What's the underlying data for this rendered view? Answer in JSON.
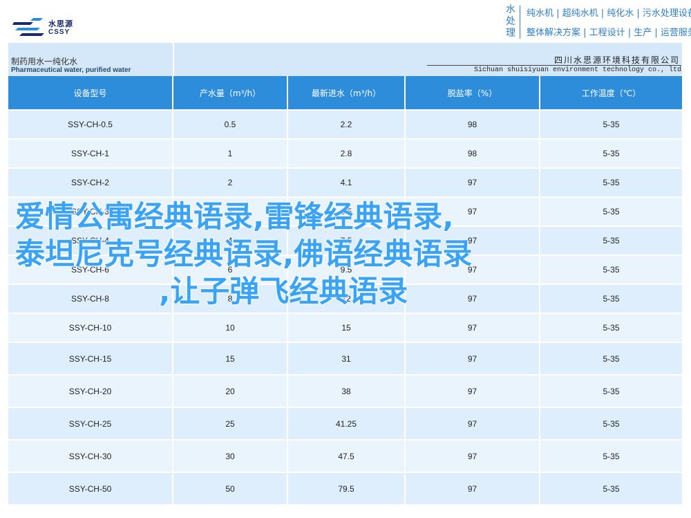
{
  "brand": {
    "name_cn": "水思源",
    "name_en": "CSSY",
    "accent": "#2e8ddb"
  },
  "header": {
    "vertical_text": "水处理",
    "tagline1": "纯水机 | 超纯水机 | 纯化水 | 污水处理设备",
    "tagline2": "整体解决方案 | 工程设计 | 生产 | 运营服务"
  },
  "band": {
    "title": "制药用水一纯化水",
    "subtitle": "Pharmaceutical water, purified water",
    "company_cn": "四川水思源环境科技有限公司",
    "company_en": "Sichuan shuisiyuan environment technology co., ltd"
  },
  "table": {
    "headers": [
      "设备型号",
      "产水量（m³/h）",
      "最新进水（m³/h）",
      "脱盐率（%）",
      "工作温度（℃）"
    ],
    "rows": [
      [
        "SSY-CH-0.5",
        "0.5",
        "2.2",
        "98",
        "5-35"
      ],
      [
        "SSY-CH-1",
        "1",
        "2.8",
        "98",
        "5-35"
      ],
      [
        "SSY-CH-2",
        "2",
        "4.1",
        "97",
        "5-35"
      ],
      [
        "SSY-CH-3",
        "3",
        "6.5",
        "97",
        "5-35"
      ],
      [
        "SSY-CH-4",
        "4",
        "7.5",
        "97",
        "5-35"
      ],
      [
        "SSY-CH-6",
        "6",
        "9.5",
        "97",
        "5-35"
      ],
      [
        "SSY-CH-8",
        "8",
        "12",
        "97",
        "5-35"
      ],
      [
        "SSY-CH-10",
        "10",
        "15",
        "97",
        "5-35"
      ],
      [
        "SSY-CH-15",
        "15",
        "31",
        "97",
        "5-35"
      ],
      [
        "SSY-CH-20",
        "20",
        "38",
        "97",
        "5-35"
      ],
      [
        "SSY-CH-25",
        "25",
        "41.25",
        "97",
        "5-35"
      ],
      [
        "SSY-CH-30",
        "30",
        "47.5",
        "97",
        "5-35"
      ],
      [
        "SSY-CH-50",
        "50",
        "79.5",
        "97",
        "5-35"
      ]
    ]
  },
  "overlay": {
    "line1": "爱情公寓经典语录,雷锋经典语录,",
    "line2": "泰坦尼克号经典语录,佛语经典语录",
    "line3": ",让子弹飞经典语录"
  }
}
